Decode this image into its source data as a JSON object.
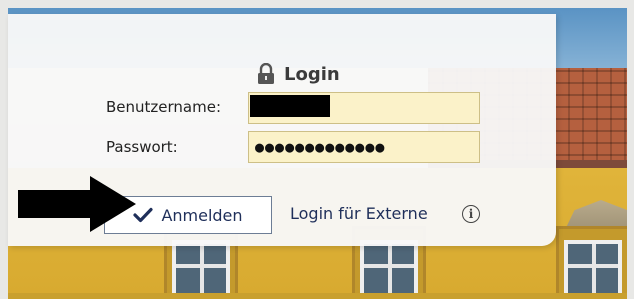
{
  "login": {
    "title": "Login",
    "username_label": "Benutzername:",
    "username_value": "",
    "password_label": "Passwort:",
    "password_value": "●●●●●●●●●●●●●",
    "submit_label": "Anmelden",
    "external_link": "Login für Externe"
  },
  "icons": {
    "title_icon": "lock-icon",
    "submit_icon": "checkmark-icon",
    "info_icon": "info-icon",
    "annotation": "arrow-right-icon"
  },
  "colors": {
    "input_bg": "#fbf2c9",
    "button_text": "#1f2f5a",
    "card_bg": "#f8f8f8"
  }
}
